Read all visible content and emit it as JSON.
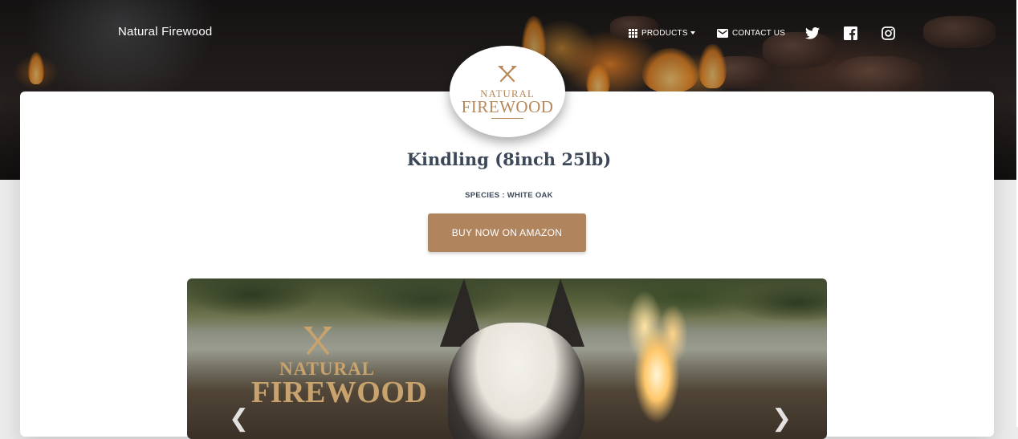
{
  "brand": "Natural Firewood",
  "nav": {
    "products_label": "PRODUCTS",
    "contact_label": "CONTACT US",
    "social": [
      "twitter-icon",
      "facebook-icon",
      "instagram-icon"
    ]
  },
  "logo": {
    "line1": "NATURAL",
    "line2": "FIREWOOD"
  },
  "product": {
    "title": "Kindling (8inch 25lb)",
    "species": "SPECIES : WHITE OAK",
    "buy_label": "BUY NOW ON AMAZON"
  },
  "carousel": {
    "watermark_line1": "NATURAL",
    "watermark_line2": "FIREWOOD",
    "prev_icon": "chevron-left-icon",
    "next_icon": "chevron-right-icon"
  },
  "colors": {
    "accent": "#b0845d",
    "logo_gold": "#b8895a",
    "title": "#3c4858"
  }
}
